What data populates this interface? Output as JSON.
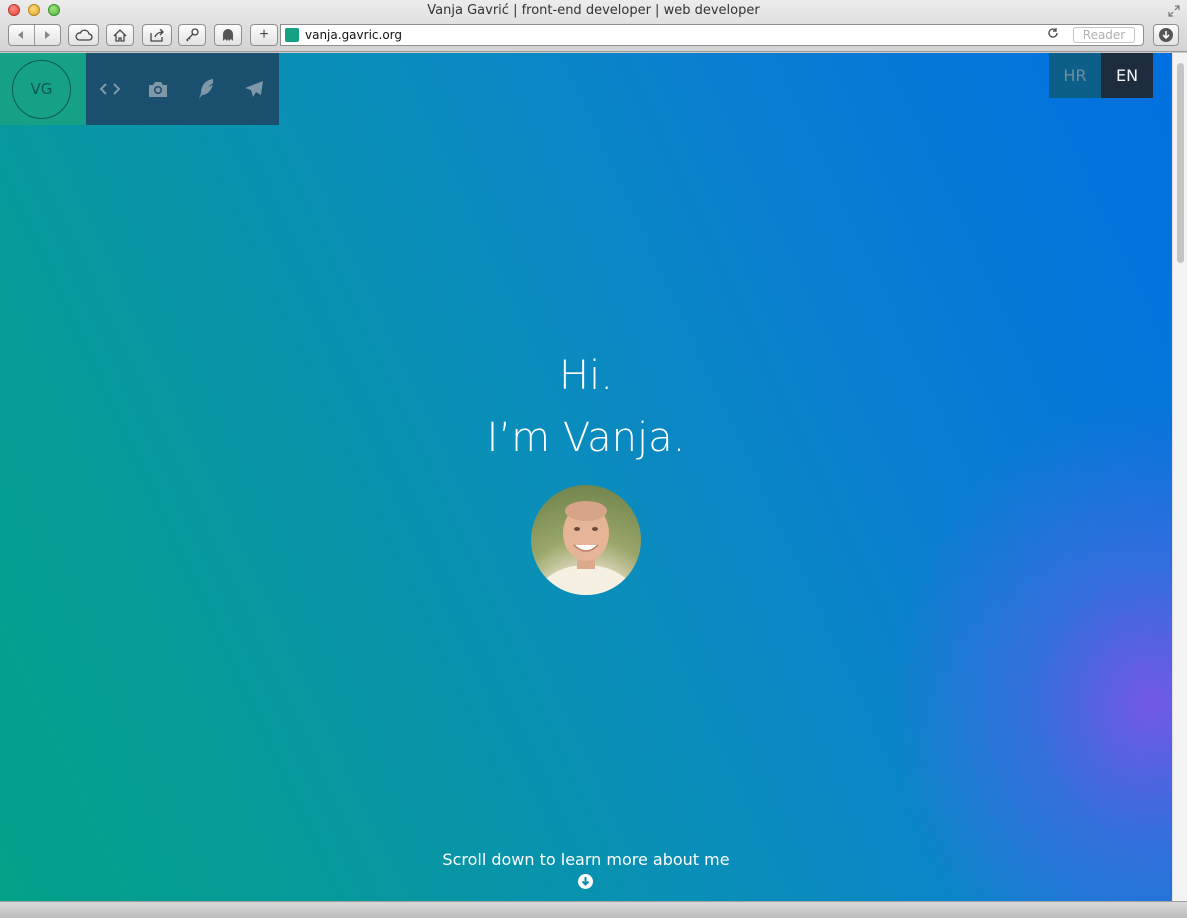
{
  "window": {
    "title": "Vanja Gavrić | front-end developer | web developer"
  },
  "browser": {
    "url": "vanja.gavric.org",
    "reader_label": "Reader",
    "icons": [
      "back-icon",
      "forward-icon",
      "icloud-icon",
      "home-icon",
      "share-icon",
      "key-icon",
      "ghostery-icon",
      "add-icon",
      "reload-icon",
      "download-icon",
      "fullscreen-icon"
    ]
  },
  "site": {
    "logo": "VG",
    "nav_icons": [
      "code-icon",
      "camera-icon",
      "feather-icon",
      "paper-plane-icon"
    ],
    "languages": {
      "hr": "HR",
      "en": "EN"
    },
    "hero": {
      "line1": "Hi.",
      "line2": "I’m Vanja."
    },
    "scroll_hint": "Scroll down to learn more about me",
    "colors": {
      "logo_bg": "#16a086",
      "nav_bg": "#1a4f6e",
      "lang_active_bg": "#1d2d3d",
      "lang_inactive_bg": "#0c5f88",
      "gradient_start": "#04a087",
      "gradient_end": "#0070e0",
      "glow": "#7856e6"
    }
  }
}
